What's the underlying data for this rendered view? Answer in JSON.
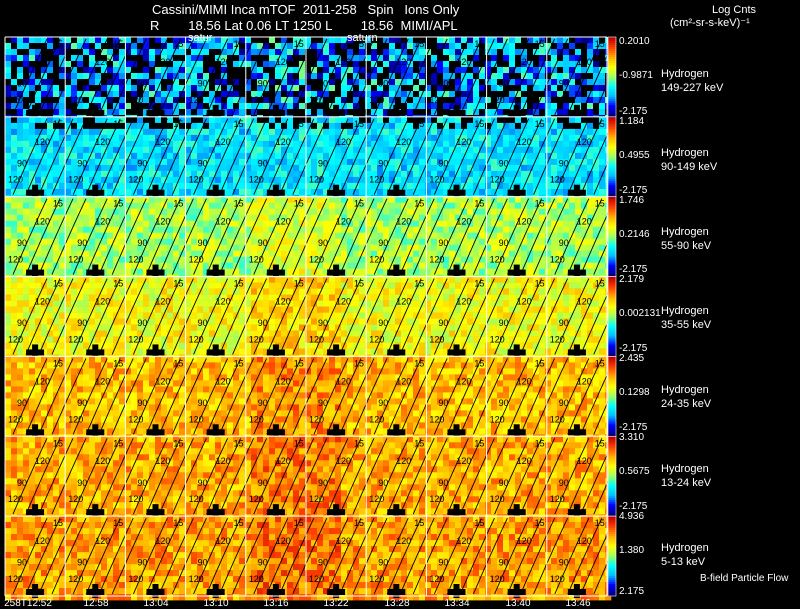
{
  "title_line1": "Cassini/MIMI Inca mTOF  2011-258   Spin   Ions Only",
  "title_line2": "R        18.56 Lat 0.06 LT 1250 L        18.56  MIMI/APL",
  "overlay_labels": [
    "satur",
    "saturn"
  ],
  "units_title": "Log Cnts",
  "units_sub": "(cm²-sr-s-keV)⁻¹",
  "footer_note": "B-field Particle Flow",
  "x_ticks": [
    "258T12:52",
    "12:58",
    "13:04",
    "13:10",
    "13:16",
    "13:22",
    "13:28",
    "13:34",
    "13:40",
    "13:46"
  ],
  "contour_labels": [
    "15",
    "60",
    "90",
    "120"
  ],
  "colors": {
    "background": "#000000",
    "grid": "#ffffff",
    "contour": "#000000",
    "colormap": [
      "#00007f",
      "#0000ff",
      "#00bfff",
      "#00ffff",
      "#9fff60",
      "#ffff00",
      "#ffaf00",
      "#ff4000",
      "#c00000"
    ]
  },
  "chart_data": {
    "type": "heatmap",
    "x_label": "",
    "layout": "stacked panels, one per energy channel, colorbar on right",
    "panels": [
      {
        "species": "Hydrogen",
        "energy": "149-227 keV",
        "cbar": [
          "0.2010",
          "-0.9871",
          "-2.175"
        ],
        "level": 0.18
      },
      {
        "species": "Hydrogen",
        "energy": "90-149 keV",
        "cbar": [
          "1.184",
          "0.4955",
          "-2.175"
        ],
        "level": 0.32
      },
      {
        "species": "Hydrogen",
        "energy": "55-90 keV",
        "cbar": [
          "1.746",
          "0.2146",
          "-2.175"
        ],
        "level": 0.52
      },
      {
        "species": "Hydrogen",
        "energy": "35-55 keV",
        "cbar": [
          "2.179",
          "0.002131",
          "-2.175"
        ],
        "level": 0.62
      },
      {
        "species": "Hydrogen",
        "energy": "24-35 keV",
        "cbar": [
          "2.435",
          "0.1298",
          "-2.175"
        ],
        "level": 0.72
      },
      {
        "species": "Hydrogen",
        "energy": "13-24 keV",
        "cbar": [
          "3.310",
          "0.5675",
          "-2.175"
        ],
        "level": 0.74
      },
      {
        "species": "Hydrogen",
        "energy": "5-13 keV",
        "cbar": [
          "4.936",
          "1.380",
          "2.175"
        ],
        "level": 0.76
      }
    ]
  }
}
